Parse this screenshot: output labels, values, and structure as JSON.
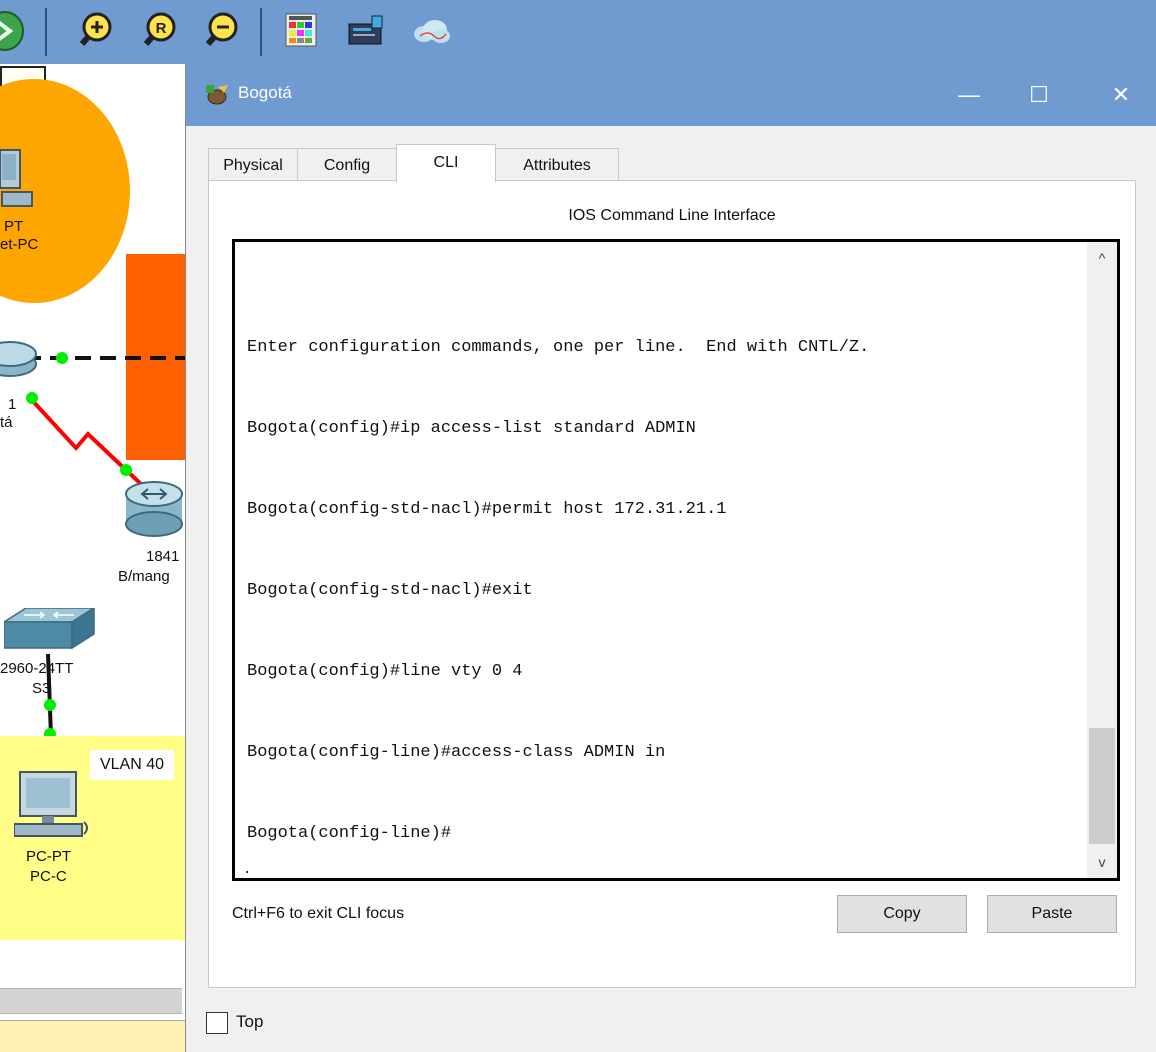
{
  "toolbar": {
    "icons": [
      "navigate-icon",
      "zoom-in-icon",
      "zoom-reset-icon",
      "zoom-out-icon",
      "palette-icon",
      "custom-device-icon",
      "cloud-icon"
    ]
  },
  "workspace": {
    "labels": {
      "top_pc_type": "PT",
      "top_pc_name": "et-PC",
      "router_left_num": "1",
      "router_left_name": "tá",
      "router_right_model": "1841",
      "router_right_name": "B/mang",
      "switch_model": "2960-24TT",
      "switch_name": "S3",
      "vlan": "VLAN 40",
      "pc_type": "PC-PT",
      "pc_name": "PC-C"
    },
    "colors": {
      "cloud": "#ffa500",
      "network_block": "#ff6000",
      "vlan_area": "#ffff88",
      "link_serial": "#ff0000",
      "link_up": "#00ee00"
    }
  },
  "dialog": {
    "title": "Bogotá",
    "window_controls": {
      "minimize": "—",
      "maximize": "☐",
      "close": "✕"
    },
    "tabs": [
      {
        "label": "Physical",
        "active": false
      },
      {
        "label": "Config",
        "active": false
      },
      {
        "label": "CLI",
        "active": true
      },
      {
        "label": "Attributes",
        "active": false
      }
    ],
    "panel_title": "IOS Command Line Interface",
    "terminal_lines": [
      "Enter configuration commands, one per line.  End with CNTL/Z.",
      "Bogota(config)#ip access-list standard ADMIN",
      "Bogota(config-std-nacl)#permit host 172.31.21.1",
      "Bogota(config-std-nacl)#exit",
      "Bogota(config)#line vty 0 4",
      "Bogota(config-line)#access-class ADMIN in",
      "Bogota(config-line)#"
    ],
    "terminal_cursor": ".",
    "scroll_up": "^",
    "scroll_down": "v",
    "hint": "Ctrl+F6 to exit CLI focus",
    "copy_label": "Copy",
    "paste_label": "Paste",
    "top_checkbox": {
      "label": "Top",
      "checked": false
    }
  }
}
